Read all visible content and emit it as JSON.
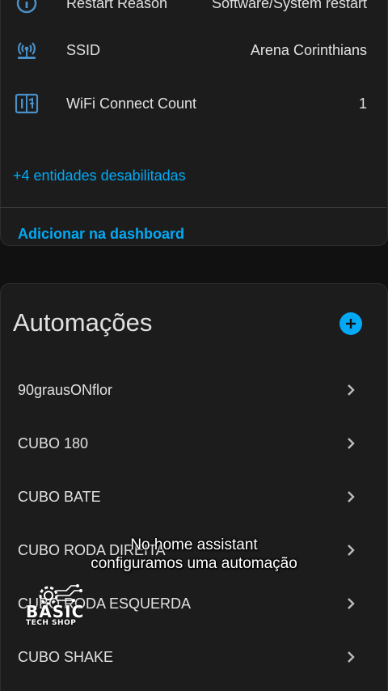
{
  "device_card": {
    "rows": [
      {
        "name": "Restart Reason",
        "value": "Software/System restart",
        "icon": "info-icon"
      },
      {
        "name": "SSID",
        "value": "Arena Corinthians",
        "icon": "wifi-antenna-icon"
      },
      {
        "name": "WiFi Connect Count",
        "value": "1",
        "icon": "counter-icon"
      }
    ],
    "disabled_entities": "+4 entidades desabilitadas",
    "add_to_dashboard": "Adicionar na dashboard"
  },
  "automations": {
    "title": "Automações",
    "add_icon": "plus-circle-icon",
    "items": [
      {
        "label": "90grausONflor"
      },
      {
        "label": "CUBO 180"
      },
      {
        "label": "CUBO BATE"
      },
      {
        "label": "CUBO RODA DIREITA"
      },
      {
        "label": "CUBO RODA ESQUERDA"
      },
      {
        "label": "CUBO SHAKE"
      }
    ]
  },
  "overlay": {
    "caption_line1": "No home assistant",
    "caption_line2": "configuramos uma automação"
  },
  "watermark": {
    "brand": "BASIC",
    "sub": "TECH SHOP"
  },
  "colors": {
    "accent": "#03a9f4",
    "icon": "#4a90c8",
    "card": "#1c1c1c",
    "background": "#111111"
  }
}
